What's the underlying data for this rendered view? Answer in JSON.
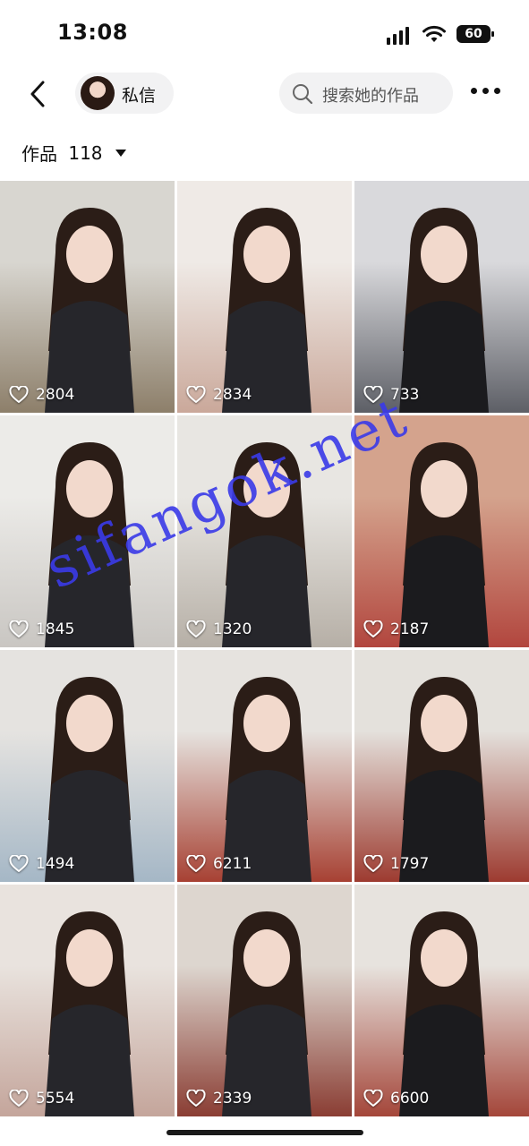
{
  "status": {
    "time": "13:08",
    "battery": "60"
  },
  "header": {
    "dm_label": "私信",
    "search_placeholder": "搜索她的作品"
  },
  "works": {
    "label": "作品",
    "count": "118"
  },
  "tiles": [
    {
      "likes": "2804",
      "bg": "#8d7f6a",
      "top": "#d8d6d0"
    },
    {
      "likes": "2834",
      "bg": "#caa89a",
      "top": "#efeae6"
    },
    {
      "likes": "733",
      "bg": "#5d5f66",
      "top": "#d9d9dc"
    },
    {
      "likes": "1845",
      "bg": "#c9c6c2",
      "top": "#ecebe8"
    },
    {
      "likes": "1320",
      "bg": "#b6afa6",
      "top": "#e8e6e2"
    },
    {
      "likes": "2187",
      "bg": "#b2463e",
      "top": "#d4a38d"
    },
    {
      "likes": "1494",
      "bg": "#a5b7c6",
      "top": "#e5e3e0"
    },
    {
      "likes": "6211",
      "bg": "#a74133",
      "top": "#e6e3df"
    },
    {
      "likes": "1797",
      "bg": "#9d3b30",
      "top": "#e4e1dc"
    },
    {
      "likes": "5554",
      "bg": "#c4a59b",
      "top": "#e9e3de"
    },
    {
      "likes": "2339",
      "bg": "#8a3d33",
      "top": "#ddd6cf"
    },
    {
      "likes": "6600",
      "bg": "#a4463a",
      "top": "#e7e3de"
    }
  ],
  "watermark": "sifangok.net",
  "colors": {
    "accent": "#3a3ae8"
  }
}
